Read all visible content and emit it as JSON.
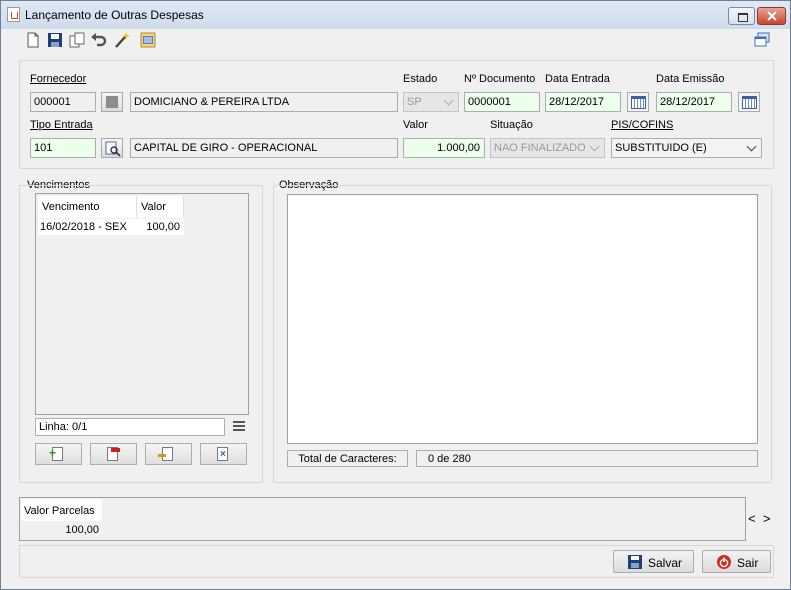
{
  "window": {
    "title": "Lançamento de Outras Despesas"
  },
  "form": {
    "fornecedor": {
      "label": "Fornecedor",
      "code": "000001",
      "name": "DOMICIANO & PEREIRA LTDA"
    },
    "estado": {
      "label": "Estado",
      "value": "SP"
    },
    "documento": {
      "label": "Nº Documento",
      "value": "0000001"
    },
    "data_entrada": {
      "label": "Data Entrada",
      "value": "28/12/2017"
    },
    "data_emissao": {
      "label": "Data Emissão",
      "value": "28/12/2017"
    },
    "tipo_entrada": {
      "label": "Tipo Entrada",
      "code": "101",
      "name": "CAPITAL DE GIRO - OPERACIONAL"
    },
    "valor": {
      "label": "Valor",
      "value": "1.000,00"
    },
    "situacao": {
      "label": "Situação",
      "value": "NAO FINALIZADO"
    },
    "pis_cofins": {
      "label": "PIS/COFINS",
      "value": "SUBSTITUIDO (E)"
    }
  },
  "vencimentos": {
    "title": "Vencimentos",
    "columns": [
      "Vencimento",
      "Valor"
    ],
    "rows": [
      {
        "vencimento": "16/02/2018 - SEX",
        "valor": "100,00"
      }
    ],
    "linha": "Linha: 0/1"
  },
  "observacao": {
    "title": "Observação",
    "text": "",
    "total_label": "Total de Caracteres:",
    "total_value": "0 de 280"
  },
  "summary": {
    "label": "Valor Parcelas",
    "value": "100,00"
  },
  "nav": {
    "prev": "<",
    "next": ">"
  },
  "actions": {
    "save": "Salvar",
    "exit": "Sair"
  },
  "toolbar": {
    "icons": [
      "new-document-icon",
      "save-disk-icon",
      "copy-icon",
      "undo-icon",
      "magic-wand-icon",
      "report-icon"
    ]
  }
}
